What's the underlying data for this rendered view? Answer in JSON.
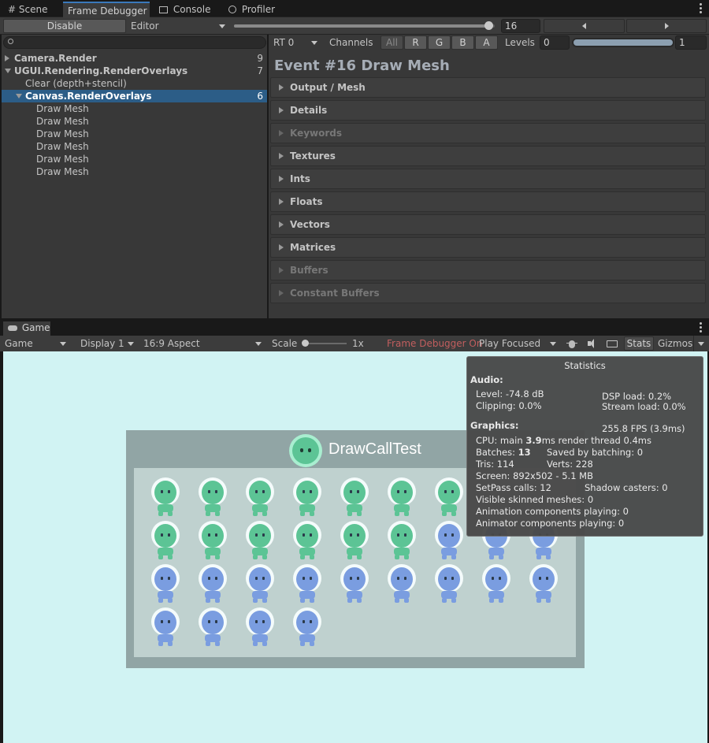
{
  "top_tabs": [
    {
      "icon": "grid-icon",
      "label": "Scene"
    },
    {
      "icon": "",
      "label": "Frame Debugger"
    },
    {
      "icon": "console-icon",
      "label": "Console"
    },
    {
      "icon": "stopwatch-icon",
      "label": "Profiler"
    }
  ],
  "toolbar": {
    "disable_label": "Disable",
    "target_label": "Editor",
    "event_value": "16",
    "slider_fraction": 0.98
  },
  "search": {
    "placeholder": ""
  },
  "tree": [
    {
      "label": "Camera.Render",
      "count": "9",
      "bold": true,
      "expanded": false
    },
    {
      "label": "UGUI.Rendering.RenderOverlays",
      "count": "7",
      "bold": true,
      "expanded": true
    },
    {
      "label": "Clear (depth+stencil)",
      "count": "",
      "bold": false
    },
    {
      "label": "Canvas.RenderOverlays",
      "count": "6",
      "bold": true,
      "expanded": true,
      "selected": true
    },
    {
      "label": "Draw Mesh",
      "count": "",
      "bold": false
    },
    {
      "label": "Draw Mesh",
      "count": "",
      "bold": false
    },
    {
      "label": "Draw Mesh",
      "count": "",
      "bold": false
    },
    {
      "label": "Draw Mesh",
      "count": "",
      "bold": false
    },
    {
      "label": "Draw Mesh",
      "count": "",
      "bold": false
    },
    {
      "label": "Draw Mesh",
      "count": "",
      "bold": false
    }
  ],
  "render_target": {
    "rt_label": "RT 0",
    "channels_label": "Channels",
    "channels": [
      "All",
      "R",
      "G",
      "B",
      "A"
    ],
    "levels_label": "Levels",
    "levels_min": "0",
    "levels_max": "1"
  },
  "event_title": "Event #16 Draw Mesh",
  "foldouts": [
    {
      "label": "Output / Mesh",
      "enabled": true
    },
    {
      "label": "Details",
      "enabled": true
    },
    {
      "label": "Keywords",
      "enabled": false
    },
    {
      "label": "Textures",
      "enabled": true
    },
    {
      "label": "Ints",
      "enabled": true
    },
    {
      "label": "Floats",
      "enabled": true
    },
    {
      "label": "Vectors",
      "enabled": true
    },
    {
      "label": "Matrices",
      "enabled": true
    },
    {
      "label": "Buffers",
      "enabled": false
    },
    {
      "label": "Constant Buffers",
      "enabled": false
    }
  ],
  "game": {
    "tab_label": "Game",
    "view_dropdown": "Game",
    "display_dropdown": "Display 1",
    "aspect_dropdown": "16:9 Aspect",
    "scale_label": "Scale",
    "scale_value": "1x",
    "frame_debugger_on": "Frame Debugger On",
    "play_mode": "Play Focused",
    "stats_label": "Stats",
    "gizmos_label": "Gizmos"
  },
  "scene": {
    "title": "DrawCallTest",
    "colors": {
      "bg": "#d1f3f3",
      "panel": "#91a5a5",
      "inner": "#bfd1cf",
      "green": "#5cc495",
      "blue": "#7a9de0"
    },
    "rows": [
      [
        "green",
        "green",
        "green",
        "green",
        "green",
        "green",
        "green"
      ],
      [
        "green",
        "green",
        "green",
        "green",
        "green",
        "green",
        "blue",
        "blue",
        "blue"
      ],
      [
        "blue",
        "blue",
        "blue",
        "blue",
        "blue",
        "blue",
        "blue",
        "blue",
        "blue"
      ],
      [
        "blue",
        "blue",
        "blue",
        "blue"
      ]
    ]
  },
  "stats": {
    "title": "Statistics",
    "audio_header": "Audio:",
    "level": "Level: -74.8 dB",
    "clipping": "Clipping: 0.0%",
    "dsp": "DSP load: 0.2%",
    "stream": "Stream load: 0.0%",
    "graphics_header": "Graphics:",
    "fps": "255.8 FPS (3.9ms)",
    "cpu_prefix": "CPU: main ",
    "cpu_main": "3.9",
    "cpu_suffix": "ms  render thread 0.4ms",
    "batches_prefix": "Batches: ",
    "batches": "13",
    "saved_batching": "Saved by batching: 0",
    "tris": "Tris: 114",
    "verts": "Verts: 228",
    "screen": "Screen: 892x502 - 5.1 MB",
    "setpass": "SetPass calls: 12",
    "shadow": "Shadow casters: 0",
    "skinned": "Visible skinned meshes: 0",
    "animation": "Animation components playing: 0",
    "animator": "Animator components playing: 0"
  }
}
